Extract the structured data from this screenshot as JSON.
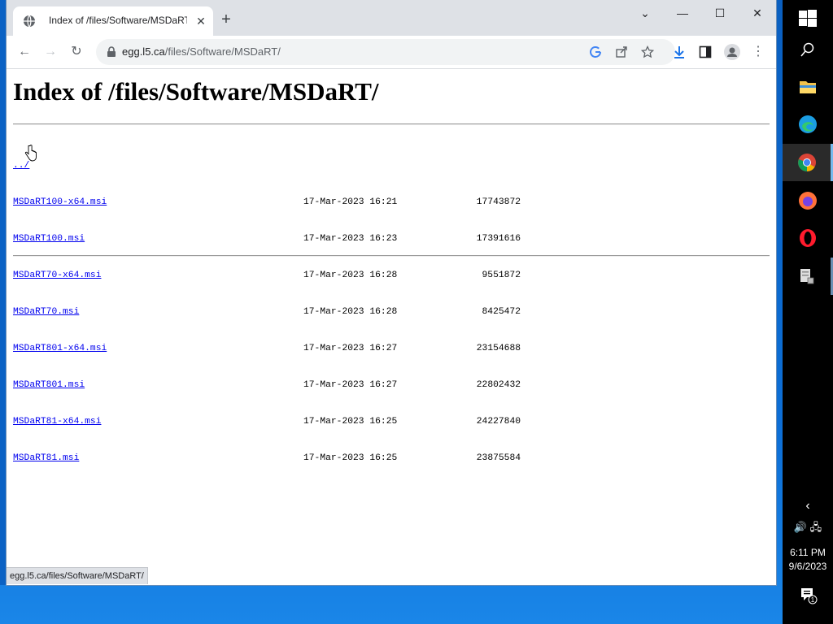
{
  "browser": {
    "tab_title": "Index of /files/Software/MSDaRT/",
    "url_host": "egg.l5.ca",
    "url_path": "/files/Software/MSDaRT/",
    "status_text": "egg.l5.ca/files/Software/MSDaRT/"
  },
  "page": {
    "heading": "Index of /files/Software/MSDaRT/",
    "parent_link": "../",
    "files": [
      {
        "name": "MSDaRT100-x64.msi",
        "date": "17-Mar-2023 16:21",
        "size": "17743872"
      },
      {
        "name": "MSDaRT100.msi",
        "date": "17-Mar-2023 16:23",
        "size": "17391616"
      },
      {
        "name": "MSDaRT70-x64.msi",
        "date": "17-Mar-2023 16:28",
        "size": "9551872"
      },
      {
        "name": "MSDaRT70.msi",
        "date": "17-Mar-2023 16:28",
        "size": "8425472"
      },
      {
        "name": "MSDaRT801-x64.msi",
        "date": "17-Mar-2023 16:27",
        "size": "23154688"
      },
      {
        "name": "MSDaRT801.msi",
        "date": "17-Mar-2023 16:27",
        "size": "22802432"
      },
      {
        "name": "MSDaRT81-x64.msi",
        "date": "17-Mar-2023 16:25",
        "size": "24227840"
      },
      {
        "name": "MSDaRT81.msi",
        "date": "17-Mar-2023 16:25",
        "size": "23875584"
      }
    ]
  },
  "taskbar": {
    "time": "6:11 PM",
    "date": "9/6/2023",
    "notification_count": "1",
    "apps": [
      "windows-start-icon",
      "search-icon",
      "file-explorer-icon",
      "edge-icon",
      "chrome-icon",
      "firefox-icon",
      "opera-icon",
      "document-app-icon"
    ]
  },
  "colors": {
    "link": "#0000ee",
    "tabstrip": "#dee1e6",
    "taskbar": "#000000",
    "desktop": "#0d6fd6"
  }
}
